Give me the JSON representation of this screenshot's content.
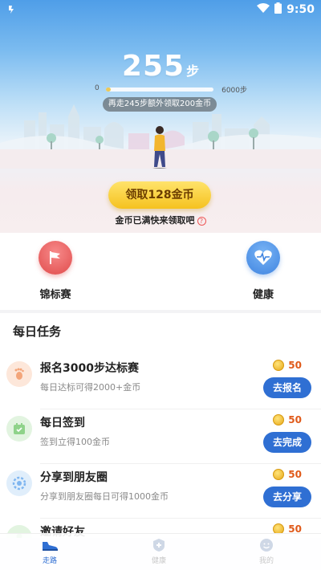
{
  "status_bar": {
    "time": "9:50"
  },
  "steps": {
    "count": "255",
    "unit": "步"
  },
  "progress": {
    "min_label": "0",
    "max_label": "6000步",
    "fraction": 0.0425
  },
  "hint": "再走245步额外领取200金币",
  "claim_button": "领取128金币",
  "full_note": "金币已满快来领取吧",
  "features": [
    {
      "label": "锦标赛",
      "icon": "flag-icon"
    },
    {
      "label": "健康",
      "icon": "heart-pulse-icon"
    }
  ],
  "tasks_title": "每日任务",
  "tasks": [
    {
      "title": "报名3000步达标赛",
      "desc": "每日达标可得2000+金币",
      "coins": "50",
      "button": "去报名",
      "icon": "footprint-icon",
      "icon_color": "#f3a57a"
    },
    {
      "title": "每日签到",
      "desc": "签到立得100金币",
      "coins": "50",
      "button": "去完成",
      "icon": "calendar-icon",
      "icon_color": "#8fd38a"
    },
    {
      "title": "分享到朋友圈",
      "desc": "分享到朋友圈每日可得1000金币",
      "coins": "50",
      "button": "去分享",
      "icon": "share-icon",
      "icon_color": "#7fb6f0"
    },
    {
      "title": "邀请好友",
      "desc": "",
      "coins": "50",
      "button": "",
      "icon": "invite-icon",
      "icon_color": "#8fd38a"
    }
  ],
  "bottom_nav": [
    {
      "label": "走路",
      "icon": "shoe-icon",
      "active": true
    },
    {
      "label": "健康",
      "icon": "health-plus-icon",
      "active": false
    },
    {
      "label": "我的",
      "icon": "smiley-icon",
      "active": false
    }
  ],
  "colors": {
    "accent_blue": "#2f6fd3",
    "coin_amount": "#e05a1a",
    "claim_gold": "#f5c21f"
  }
}
